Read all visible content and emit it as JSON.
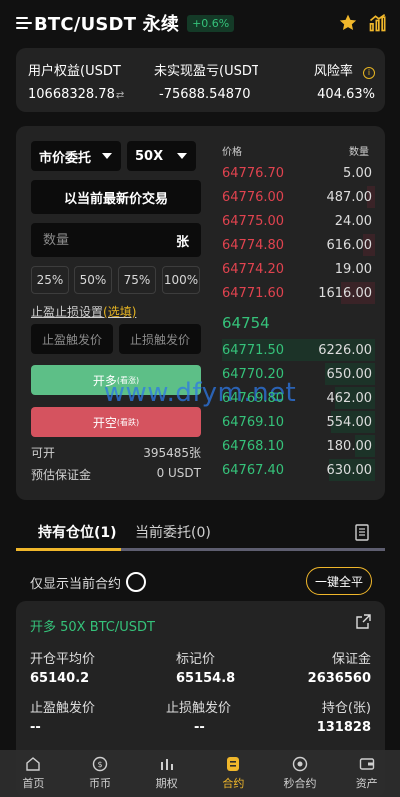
{
  "header": {
    "pair": "BTC/USDT 永续",
    "change": "+0.6%"
  },
  "summary": {
    "equity_label": "用户权益(USDT",
    "equity_value": "10668328.78",
    "unrealized_label": "未实现盈亏(USDT",
    "unrealized_value": "-75688.54870",
    "risk_label": "风险率",
    "risk_value": "404.63%"
  },
  "trade": {
    "order_type": "市价委托",
    "leverage": "50X",
    "market_button": "以当前最新价交易",
    "qty_placeholder": "数量",
    "qty_unit": "张",
    "percents": [
      "25%",
      "50%",
      "75%",
      "100%"
    ],
    "sl_tp_label": "止盈止损设置",
    "sl_tp_optional": "(选填)",
    "tp_placeholder": "止盈触发价",
    "sl_placeholder": "止损触发价",
    "long_label": "开多",
    "long_sub": "(看涨)",
    "short_label": "开空",
    "short_sub": "(看跌)",
    "available_label": "可开",
    "available_value": "395485张",
    "margin_label": "预估保证金",
    "margin_value": "0 USDT"
  },
  "orderbook": {
    "price_header": "价格",
    "qty_header": "数量",
    "asks": [
      {
        "price": "64776.70",
        "qty": "5.00"
      },
      {
        "price": "64776.00",
        "qty": "487.00"
      },
      {
        "price": "64775.00",
        "qty": "24.00"
      },
      {
        "price": "64774.80",
        "qty": "616.00"
      },
      {
        "price": "64774.20",
        "qty": "19.00"
      },
      {
        "price": "64771.60",
        "qty": "1616.00"
      }
    ],
    "last_price": "64754",
    "bids": [
      {
        "price": "64771.50",
        "qty": "6226.00"
      },
      {
        "price": "64770.20",
        "qty": "650.00"
      },
      {
        "price": "64769.80",
        "qty": "462.00"
      },
      {
        "price": "64769.10",
        "qty": "554.00"
      },
      {
        "price": "64768.10",
        "qty": "180.00"
      },
      {
        "price": "64767.40",
        "qty": "630.00"
      }
    ]
  },
  "tabs": {
    "positions": "持有仓位(1)",
    "orders": "当前委托(0)"
  },
  "filters": {
    "only_current": "仅显示当前合约",
    "close_all": "一键全平"
  },
  "position": {
    "title": "开多 50X BTC/USDT",
    "avg_open_label": "开仓平均价",
    "avg_open_value": "65140.2",
    "mark_label": "标记价",
    "mark_value": "65154.8",
    "margin_label": "保证金",
    "margin_value": "2636560",
    "tp_label": "止盈触发价",
    "tp_value": "--",
    "sl_label": "止损触发价",
    "sl_value": "--",
    "holding_label": "持仓(张)",
    "holding_value": "131828"
  },
  "nav": {
    "items": [
      "首页",
      "币币",
      "期权",
      "合约",
      "秒合约",
      "资产"
    ],
    "active": "合约"
  },
  "watermark": "www.dfym.net",
  "colors": {
    "up": "#35c27a",
    "down": "#e0434f",
    "accent": "#f0b72b",
    "card": "#232323",
    "bg": "#111111"
  }
}
